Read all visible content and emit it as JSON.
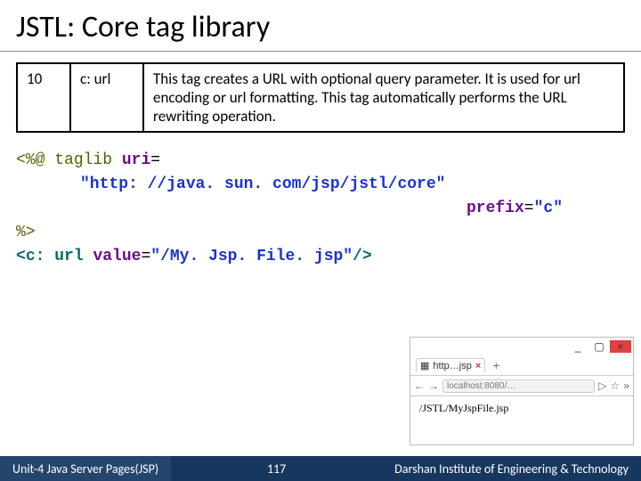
{
  "title": "JSTL: Core tag library",
  "tagrow": {
    "num": "10",
    "name": "c: url",
    "desc": "This tag creates a URL with optional query parameter. It is used for url encoding or url formatting. This tag automatically performs the URL rewriting operation."
  },
  "code": {
    "l1a": "<%@ ",
    "l1b": "taglib ",
    "l1c": "uri",
    "l1d": "=",
    "l2": "\"http: //java. sun. com/jsp/jstl/core\"",
    "l3a": "prefix",
    "l3b": "=",
    "l3c": "\"c\"",
    "l4": "%>",
    "l5a": "<",
    "l5b": "c: url ",
    "l5c": "value",
    "l5d": "=",
    "l5e": "\"/My. Jsp. File. jsp\"",
    "l5f": "/>"
  },
  "browser": {
    "tab_label": "http…jsp",
    "tab_close": "×",
    "plus": "+",
    "min": "_",
    "max": "▢",
    "close": "×",
    "back": "←",
    "fwd": "→",
    "url_text": "localhost:8080/…",
    "page_text": "/JSTL/MyJspFile.jsp",
    "play": "▷",
    "star": "☆",
    "menu": "»"
  },
  "footer": {
    "left": "Unit-4 Java Server Pages(JSP)",
    "page": "117",
    "right": "Darshan Institute of Engineering & Technology"
  }
}
